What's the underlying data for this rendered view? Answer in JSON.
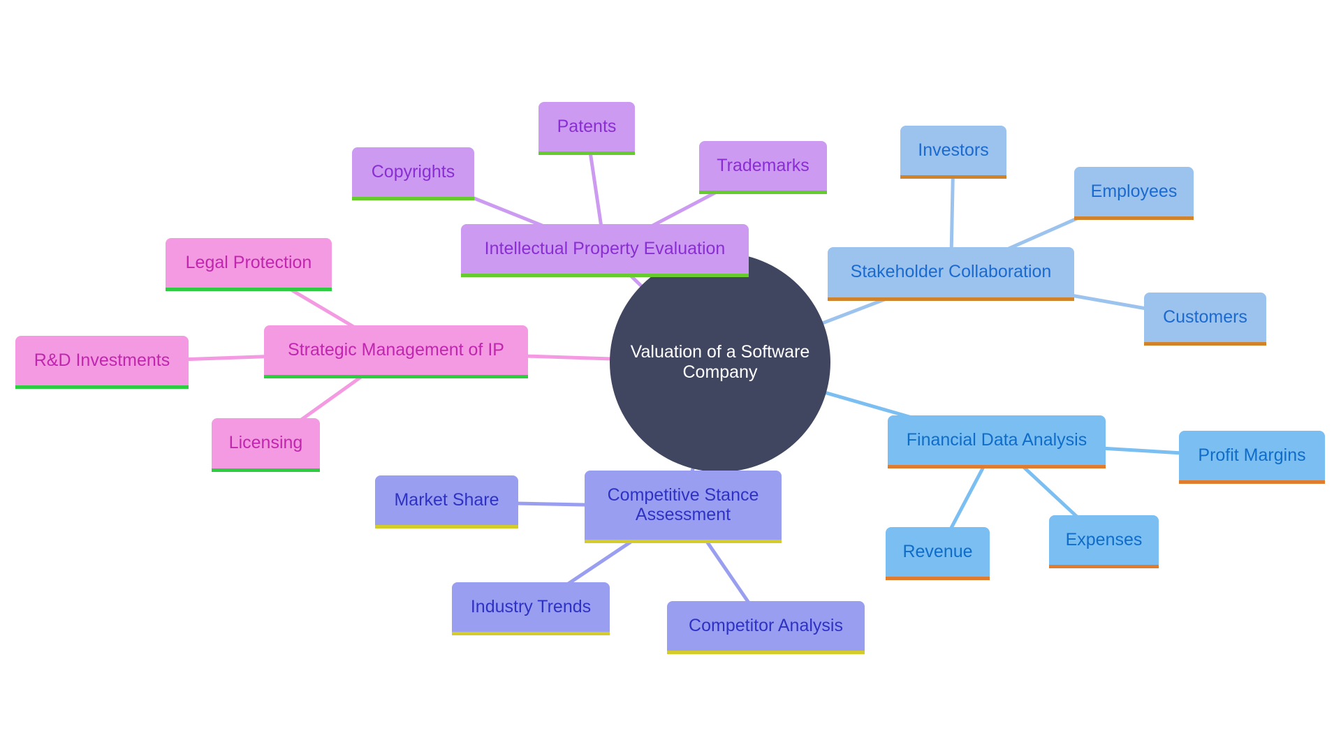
{
  "diagram": {
    "type": "mindmap",
    "root": {
      "id": "root",
      "label": "Valuation of a Software Company",
      "color": "#404560",
      "text_color": "#ffffff"
    },
    "branches": [
      {
        "id": "ip",
        "label": "Intellectual Property Evaluation",
        "style": "b-ip",
        "colors": {
          "fill": "#CC9AF0",
          "text": "#8A2ED4",
          "border": "#66CC2E",
          "edge": "#CC9AF0"
        },
        "children": [
          {
            "id": "copyrights",
            "label": "Copyrights"
          },
          {
            "id": "patents",
            "label": "Patents"
          },
          {
            "id": "trademarks",
            "label": "Trademarks"
          }
        ]
      },
      {
        "id": "stak",
        "label": "Stakeholder Collaboration",
        "style": "b-stak",
        "colors": {
          "fill": "#9CC3EE",
          "text": "#1A6AD0",
          "border": "#D0832A",
          "edge": "#9CC3EE"
        },
        "children": [
          {
            "id": "investors",
            "label": "Investors"
          },
          {
            "id": "employees",
            "label": "Employees"
          },
          {
            "id": "customers",
            "label": "Customers"
          }
        ]
      },
      {
        "id": "fin",
        "label": "Financial Data Analysis",
        "style": "b-fin",
        "colors": {
          "fill": "#7BBFF2",
          "text": "#0F6CC8",
          "border": "#E07C2E",
          "edge": "#7BBFF2"
        },
        "children": [
          {
            "id": "profit",
            "label": "Profit Margins"
          },
          {
            "id": "revenue",
            "label": "Revenue"
          },
          {
            "id": "expenses",
            "label": "Expenses"
          }
        ]
      },
      {
        "id": "comp",
        "label": "Competitive Stance Assessment",
        "style": "b-comp",
        "colors": {
          "fill": "#999EF0",
          "text": "#2E32C4",
          "border": "#D4CC2A",
          "edge": "#999EF0"
        },
        "children": [
          {
            "id": "market",
            "label": "Market Share"
          },
          {
            "id": "industry",
            "label": "Industry Trends"
          },
          {
            "id": "competitor",
            "label": "Competitor Analysis"
          }
        ]
      },
      {
        "id": "smip",
        "label": "Strategic Management of IP",
        "style": "b-smip",
        "colors": {
          "fill": "#F39AE2",
          "text": "#C026AE",
          "border": "#2ECC40",
          "edge": "#F39AE2"
        },
        "children": [
          {
            "id": "legal",
            "label": "Legal Protection"
          },
          {
            "id": "rnd",
            "label": "R&D Investments"
          },
          {
            "id": "licensing",
            "label": "Licensing"
          }
        ]
      }
    ]
  }
}
